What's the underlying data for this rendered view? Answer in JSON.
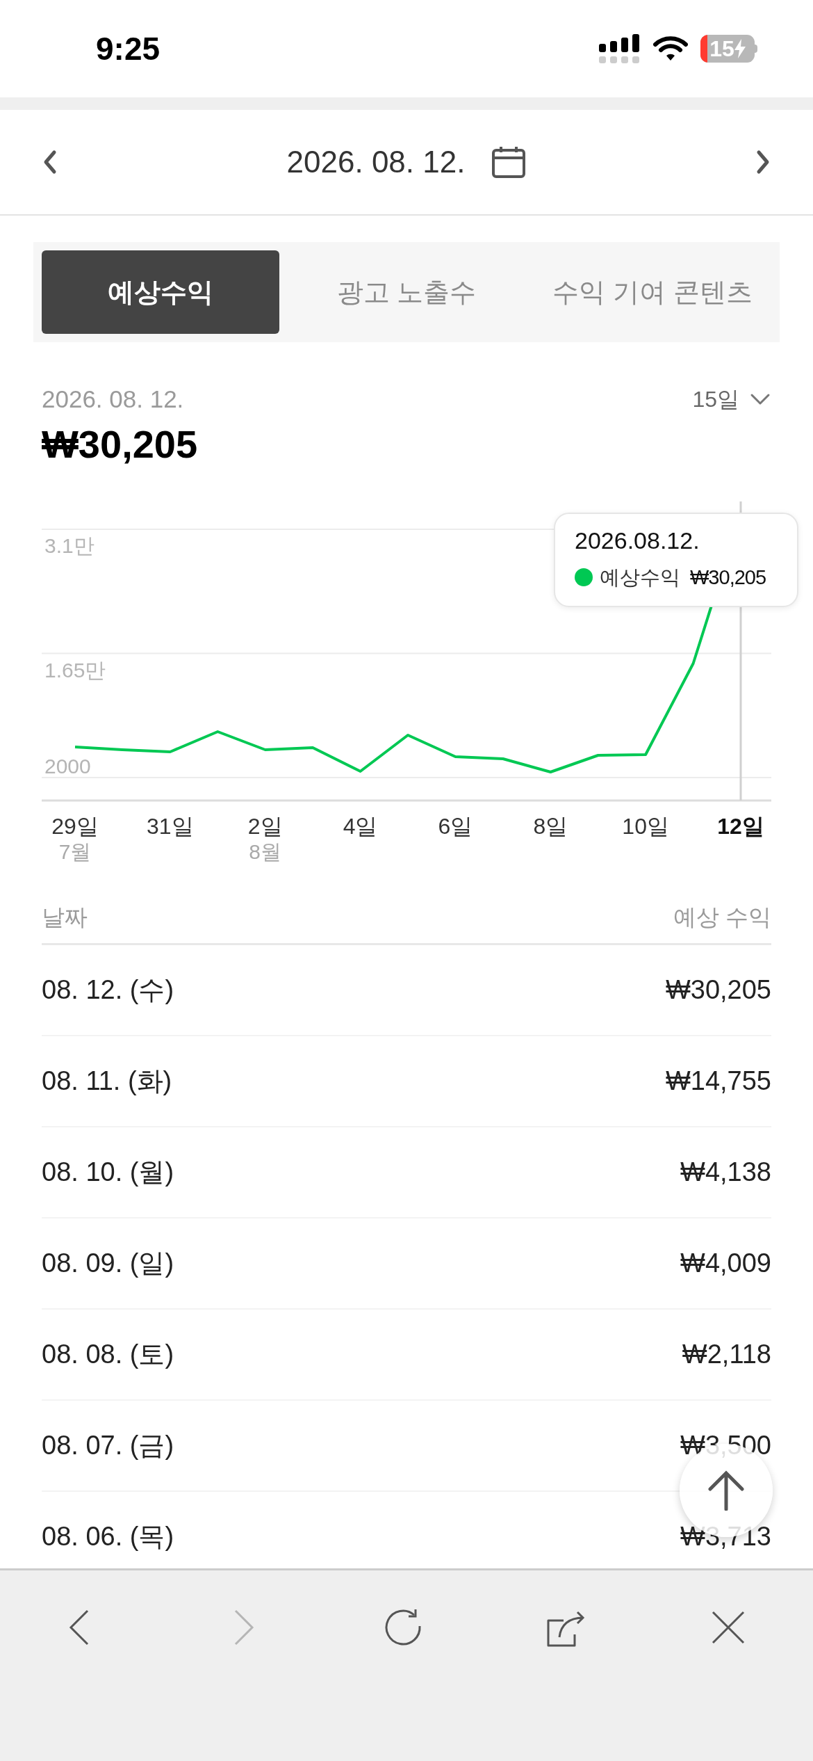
{
  "status_bar": {
    "time": "9:25",
    "battery": "15",
    "charging": true
  },
  "date_nav": {
    "date": "2026. 08. 12."
  },
  "tabs": [
    {
      "label": "예상수익",
      "selected": true
    },
    {
      "label": "광고 노출수",
      "selected": false
    },
    {
      "label": "수익 기여 콘텐츠",
      "selected": false
    }
  ],
  "summary": {
    "date": "2026. 08. 12.",
    "amount": "₩30,205",
    "period": "15일"
  },
  "chart": {
    "y_labels": [
      "3.1만",
      "1.65만",
      "2000"
    ],
    "x_labels": [
      {
        "label": "29일",
        "month": "7월",
        "selected": false
      },
      {
        "label": "31일",
        "selected": false
      },
      {
        "label": "2일",
        "month": "8월",
        "selected": false
      },
      {
        "label": "4일",
        "selected": false
      },
      {
        "label": "6일",
        "selected": false
      },
      {
        "label": "8일",
        "selected": false
      },
      {
        "label": "10일",
        "selected": false
      },
      {
        "label": "12일",
        "selected": true
      }
    ],
    "tooltip": {
      "date": "2026.08.12.",
      "series_name": "예상수익",
      "value": "₩30,205"
    }
  },
  "table": {
    "columns": [
      "날짜",
      "예상 수익"
    ],
    "rows": [
      [
        "08. 12. (수)",
        "₩30,205"
      ],
      [
        "08. 11. (화)",
        "₩14,755"
      ],
      [
        "08. 10. (월)",
        "₩4,138"
      ],
      [
        "08. 09. (일)",
        "₩4,009"
      ],
      [
        "08. 08. (토)",
        "₩2,118"
      ],
      [
        "08. 07. (금)",
        "₩3,500"
      ],
      [
        "08. 06. (목)",
        "₩3,713"
      ]
    ]
  },
  "toolbar": [
    {
      "kind": "back",
      "disabled": false
    },
    {
      "kind": "forward",
      "disabled": true
    },
    {
      "kind": "reload",
      "disabled": false
    },
    {
      "kind": "share",
      "disabled": false
    },
    {
      "kind": "close",
      "disabled": false
    }
  ]
}
